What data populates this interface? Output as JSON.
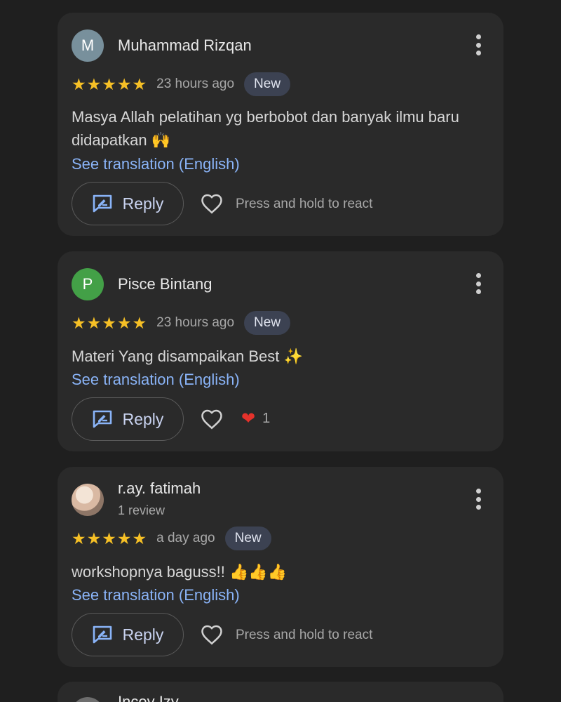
{
  "reviews": [
    {
      "avatar_letter": "M",
      "avatar_color": "#78909c",
      "name": "Muhammad Rizqan",
      "rating": 5,
      "time": "23 hours ago",
      "badge": "New",
      "text_line1": "Masya Allah pelatihan yg berbobot dan banyak ilmu baru",
      "text_line2": "didapatkan",
      "emoji": "🙌",
      "translation": "See translation (English)",
      "reply_label": "Reply",
      "react_text": "Press and hold to react"
    },
    {
      "avatar_letter": "P",
      "avatar_color": "#43a047",
      "name": "Pisce Bintang",
      "rating": 5,
      "time": "23 hours ago",
      "badge": "New",
      "text_line1": "Materi Yang disampaikan Best",
      "emoji": "✨",
      "translation": "See translation (English)",
      "reply_label": "Reply",
      "reaction_count": "1"
    },
    {
      "name": "r.ay. fatimah",
      "review_count": "1 review",
      "rating": 5,
      "time": "a day ago",
      "badge": "New",
      "text_line1": "workshopnya baguss!!",
      "emoji": "👍👍👍",
      "translation": "See translation (English)",
      "reply_label": "Reply",
      "react_text": "Press and hold to react"
    },
    {
      "name": "Incey Izy"
    }
  ],
  "icons": {
    "star": "star-icon",
    "kebab": "more-vert-icon",
    "reply": "reply-edit-icon",
    "heart": "heart-outline-icon",
    "reaction": "red-heart-icon"
  },
  "colors": {
    "star": "#f6c026",
    "link": "#8ab4f8",
    "badge_bg": "#3c4252"
  }
}
